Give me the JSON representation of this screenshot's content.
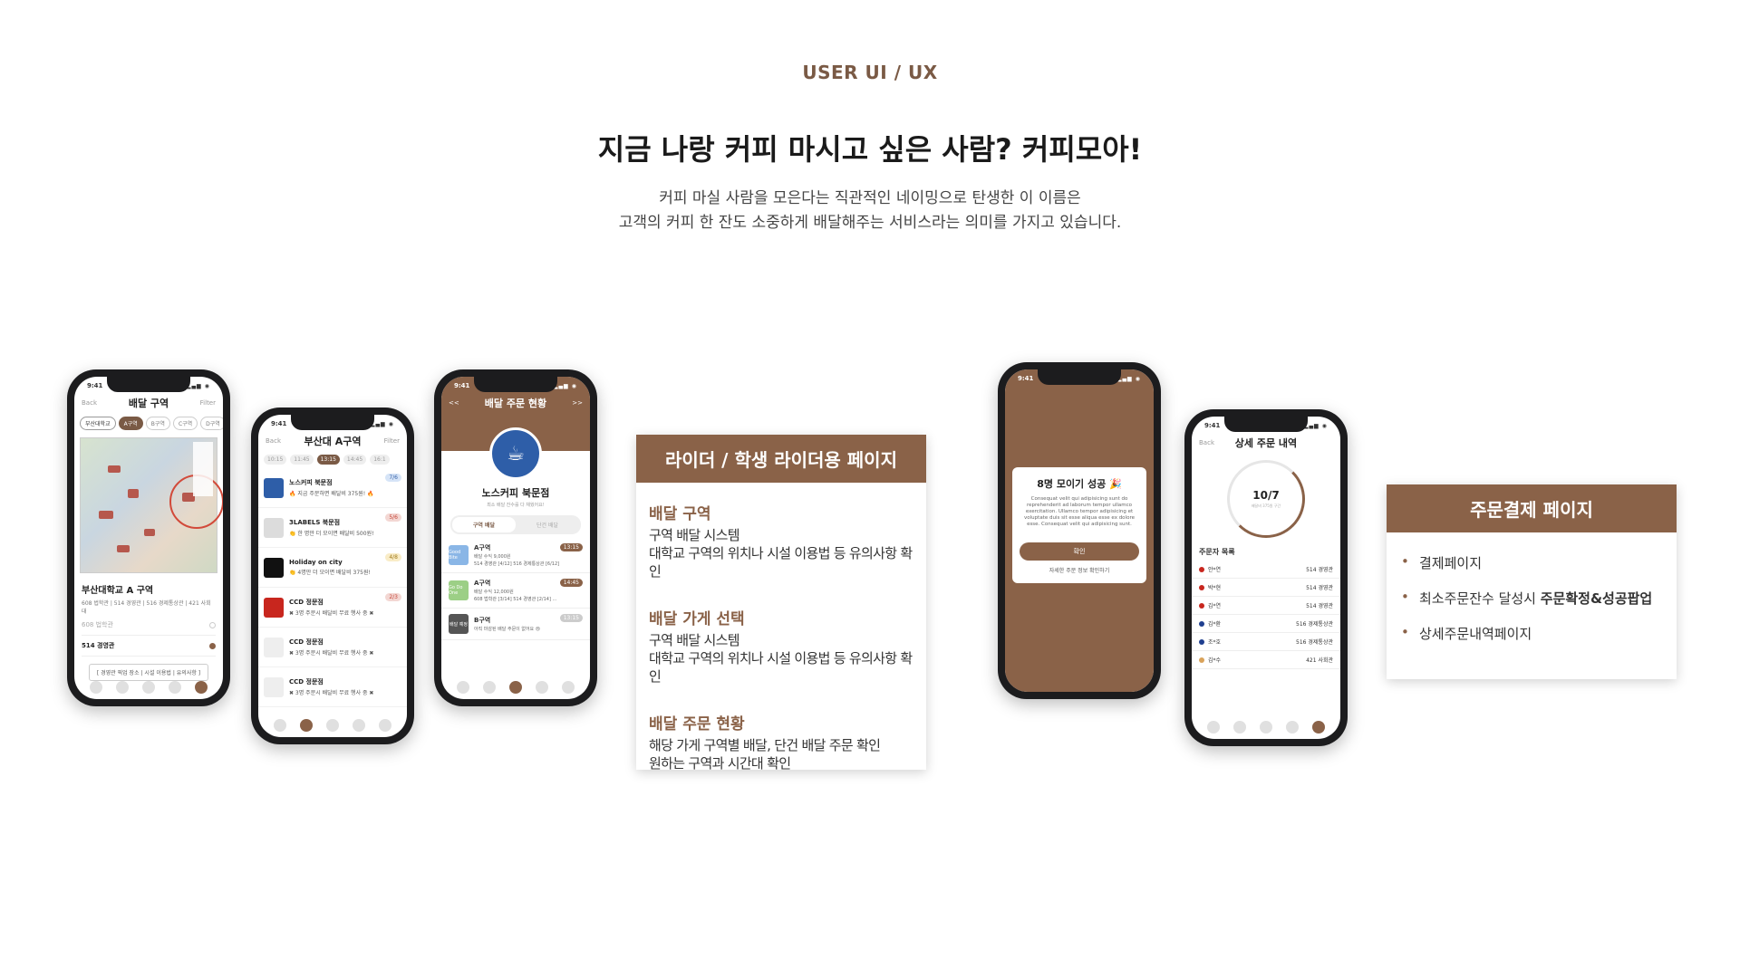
{
  "header": {
    "eyebrow": "USER UI / UX",
    "title": "지금 나랑 커피 마시고 싶은 사람? 커피모아!",
    "desc_line1": "커피 마실 사람을 모은다는 직관적인 네이밍으로 탄생한 이 이름은",
    "desc_line2": "고객의 커피 한 잔도 소중하게 배달해주는 서비스라는 의미를 가지고 있습니다."
  },
  "colors": {
    "brand": "#8a6248",
    "eyebrow": "#7a5a45"
  },
  "phone1": {
    "time": "9:41",
    "back": "Back",
    "title": "배달 구역",
    "filter": "Filter",
    "chips": [
      "부산대학교",
      "A구역",
      "B구역",
      "C구역",
      "D구역"
    ],
    "zone_title": "부산대학교 A 구역",
    "zone_desc": "608 법학관 | 514 경영관 | 516 경제통상관 | 421 사회대",
    "rows": [
      "608 법학관",
      "514 경영관"
    ],
    "notice": "[ 경영관 픽업 장소 | 시설 이용법 | 유의사항 ]"
  },
  "phone2": {
    "time": "9:41",
    "back": "Back",
    "title": "부산대 A구역",
    "filter": "Filter",
    "times": [
      "10:15",
      "11:45",
      "13:15",
      "14:45",
      "16:1"
    ],
    "stores": [
      {
        "name": "노스커피 북문점",
        "note": "🔥 지금 주문하면 배달비 375원! 🔥",
        "badge": "7/6",
        "logo": "#2e5ea8"
      },
      {
        "name": "3LABELS 북문점",
        "note": "👏 한 명만 더 모이면 배달비 500원!",
        "badge": "5/6",
        "logo": "#dcdcdc"
      },
      {
        "name": "Holiday on city",
        "note": "👏 4명만 더 모이면 배달비 375원!",
        "badge": "4/8",
        "logo": "#111111"
      },
      {
        "name": "CCD 정문점",
        "note": "✖ 3명 주문시 배달비 무료 행사 중 ✖",
        "badge": "2/3",
        "logo": "#c8261e"
      },
      {
        "name": "CCD 정문점",
        "note": "✖ 3명 주문시 배달비 무료 행사 중 ✖",
        "badge": "",
        "logo": "#eeeeee"
      },
      {
        "name": "CCD 정문점",
        "note": "✖ 3명 주문시 배달비 무료 행사 중 ✖",
        "badge": "",
        "logo": "#eeeeee"
      }
    ]
  },
  "phone3": {
    "time": "9:41",
    "prev": "<<",
    "title": "배달 주문 현황",
    "next": ">>",
    "store": "노스커피 북문점",
    "sub": "최소 배달 잔수를 다 채웠어요!",
    "seg": [
      "구역 배달",
      "단건 배달"
    ],
    "zones": [
      {
        "name": "A구역",
        "info1": "배달 수익 9,000원",
        "info2": "514 경영관 [4/12] 516 경제통상관 [6/12]",
        "time": "13:15",
        "ico": "Good Bite",
        "color": "#8ab6e6"
      },
      {
        "name": "A구역",
        "info1": "배달 수익 12,000원",
        "info2": "608 법학관 [3/14] 514 경영관 [2/14] ...",
        "time": "14:45",
        "ico": "Go Do One",
        "color": "#9ccf86"
      },
      {
        "name": "B구역",
        "info1": "",
        "info2": "아직 마감된 배달 주문이 없어요 😢",
        "time": "13:15",
        "ico": "배달 예정",
        "color": "#555555"
      }
    ]
  },
  "card1": {
    "title": "라이더 / 학생 라이더용 페이지",
    "sections": [
      {
        "title": "배달 구역",
        "l1": "구역 배달 시스템",
        "l2": "대학교 구역의 위치나 시설 이용법 등 유의사항 확인"
      },
      {
        "title": "배달 가게 선택",
        "l1": "구역 배달 시스템",
        "l2": "대학교 구역의 위치나 시설 이용법 등 유의사항 확인"
      },
      {
        "title": "배달 주문 현황",
        "l1": "해당 가게 구역별 배달, 단건 배달 주문 확인",
        "l2": "원하는 구역과 시간대 확인"
      }
    ]
  },
  "phone4": {
    "time": "9:41",
    "modal_title": "8명 모이기 성공 🎉",
    "modal_text": "Consequat velit qui adipisicing sunt do reprehenderit ad laborum tempor ullamco exercitation. Ullamco tempor adipisicing et voluptate duis sit esse aliqua esse ex dolore esse. Consequat velit qui adipisicing sunt.",
    "confirm": "확인",
    "link": "자세한 주문 정보 확인하기"
  },
  "phone5": {
    "time": "9:41",
    "back": "Back",
    "title": "상세 주문 내역",
    "gauge": "10/7",
    "gauge_sub": "배달비 375원 구간",
    "list_title": "주문자 목록",
    "orders": [
      {
        "name": "안*연",
        "place": "514 경영관",
        "color": "#c8261e"
      },
      {
        "name": "박*현",
        "place": "514 경영관",
        "color": "#c8261e"
      },
      {
        "name": "김*연",
        "place": "514 경영관",
        "color": "#c8261e"
      },
      {
        "name": "김*환",
        "place": "516 경제통상관",
        "color": "#1f3f8f"
      },
      {
        "name": "조*호",
        "place": "516 경제통상관",
        "color": "#1f3f8f"
      },
      {
        "name": "김*수",
        "place": "421 사회관",
        "color": "#d9a25a"
      }
    ]
  },
  "card2": {
    "title": "주문결제 페이지",
    "b1": "결제페이지",
    "b2_pre": "최소주문잔수 달성시 ",
    "b2_bold": "주문확정&성공팝업",
    "b3": "상세주문내역페이지"
  }
}
